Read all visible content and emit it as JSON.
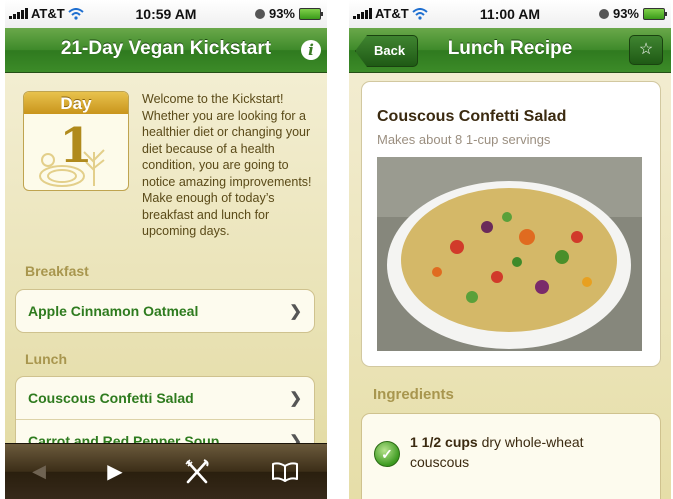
{
  "status_left": {
    "carrier": "AT&T"
  },
  "screen1": {
    "status_time": "10:59 AM",
    "battery": "93%",
    "nav_title": "21-Day Vegan Kickstart",
    "info_button": "i",
    "calendar": {
      "label": "Day",
      "number": "1"
    },
    "welcome_text": "Welcome to the Kickstart! Whether you are looking for a healthier diet or changing your diet because of a health condition, you are going to notice amazing improvements! Make enough of today’s breakfast and lunch for upcoming days.",
    "breakfast_label": "Breakfast",
    "breakfast_items": [
      "Apple Cinnamon Oatmeal"
    ],
    "lunch_label": "Lunch",
    "lunch_items": [
      "Couscous Confetti Salad",
      "Carrot and Red Pepper Soup"
    ],
    "toolbar": {
      "back_icon": "left-triangle-icon",
      "play_icon": "play-icon",
      "menu_icon": "fork-knife-icon",
      "book_icon": "book-icon"
    }
  },
  "screen2": {
    "status_time": "11:00 AM",
    "battery": "93%",
    "back_label": "Back",
    "nav_title": "Lunch Recipe",
    "star_icon": "☆",
    "recipe_title": "Couscous Confetti Salad",
    "recipe_sub": "Makes about 8 1-cup servings",
    "ingredients_label": "Ingredients",
    "ingredient": {
      "amount": "1 1/2 cups",
      "item": "dry whole-wheat couscous"
    }
  },
  "colors": {
    "nav_green": "#3e8a2a",
    "label_tan": "#a8964e",
    "link_green": "#2e7b1e",
    "toolbar_brown": "#3c2e18"
  }
}
